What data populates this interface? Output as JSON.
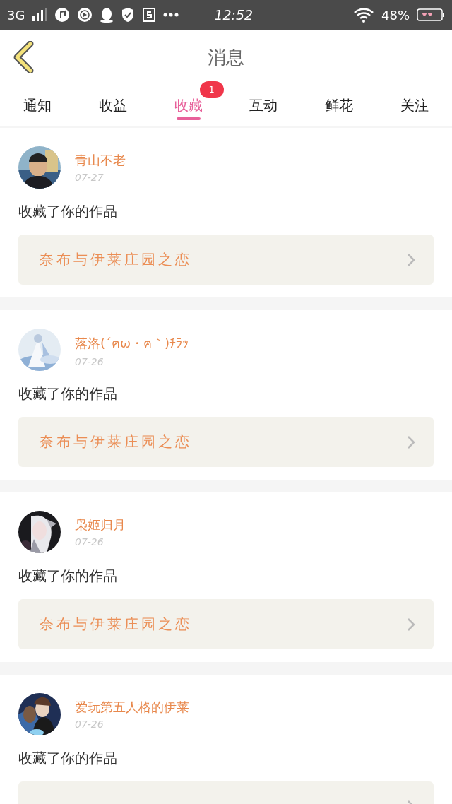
{
  "status_bar": {
    "network": "3G",
    "time": "12:52",
    "battery": "48%"
  },
  "header": {
    "title": "消息"
  },
  "tabs": [
    {
      "label": "通知",
      "selected": false
    },
    {
      "label": "收益",
      "selected": false
    },
    {
      "label": "收藏",
      "selected": true,
      "badge": "1"
    },
    {
      "label": "互动",
      "selected": false
    },
    {
      "label": "鲜花",
      "selected": false
    },
    {
      "label": "关注",
      "selected": false
    }
  ],
  "messages": [
    {
      "user": "青山不老",
      "date": "07-27",
      "text": "收藏了你的作品",
      "work": "奈布与伊莱庄园之恋"
    },
    {
      "user": "落洛(´ฅω・ฅ｀)ﾁﾗｯ",
      "date": "07-26",
      "text": "收藏了你的作品",
      "work": "奈布与伊莱庄园之恋"
    },
    {
      "user": "枭姬归月",
      "date": "07-26",
      "text": "收藏了你的作品",
      "work": "奈布与伊莱庄园之恋"
    },
    {
      "user": "爱玩第五人格的伊莱",
      "date": "07-26",
      "text": "收藏了你的作品"
    }
  ]
}
